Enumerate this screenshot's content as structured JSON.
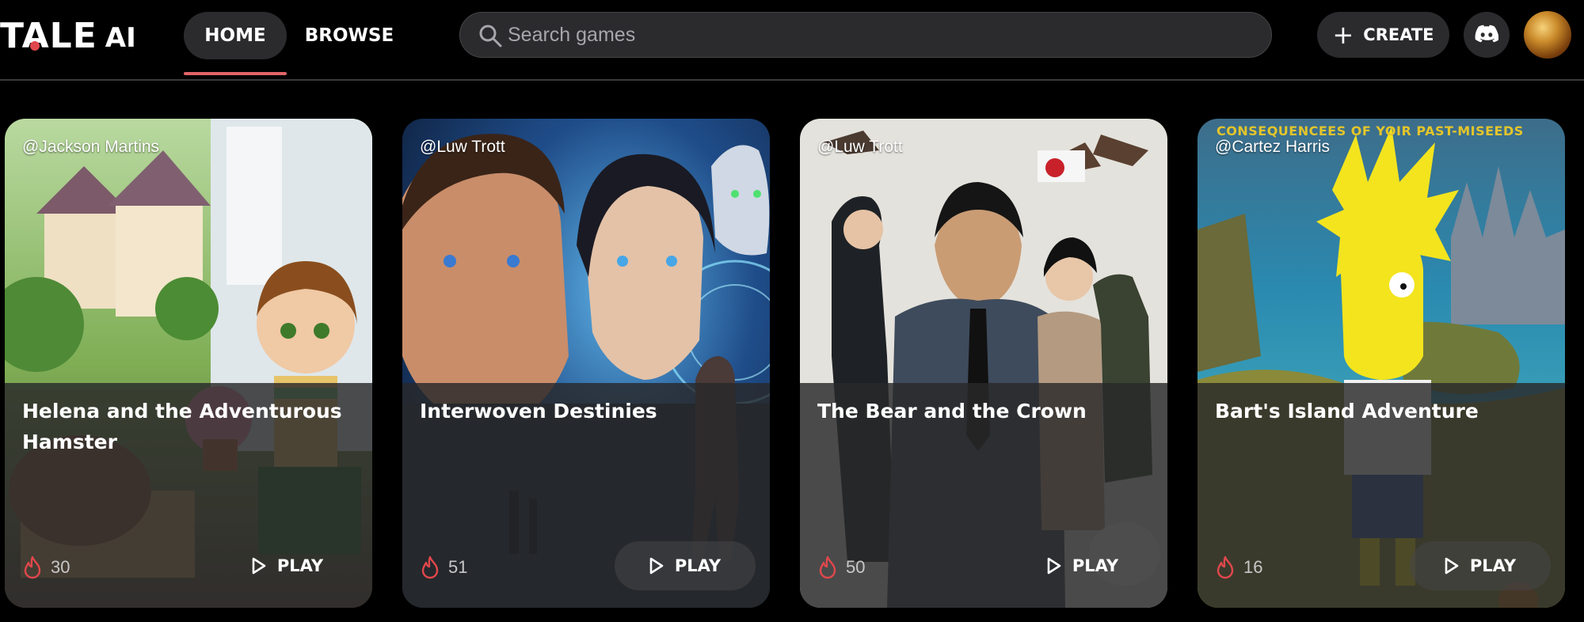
{
  "header": {
    "logo_tale": "TALE",
    "logo_ai": "AI",
    "nav": {
      "home": "HOME",
      "browse": "BROWSE"
    },
    "search": {
      "placeholder": "Search games"
    },
    "create_label": "CREATE",
    "icons": {
      "search": "search-icon",
      "create": "plus-icon",
      "discord": "discord-icon"
    }
  },
  "colors": {
    "accent": "#e0474c",
    "surface": "#2b2b2e",
    "background": "#000000"
  },
  "cards": [
    {
      "author": "@Jackson Martins",
      "title": "Helena and the Adventurous Hamster",
      "plays": "30",
      "play_label": "PLAY"
    },
    {
      "author": "@Luw Trott",
      "title": "Interwoven Destinies",
      "plays": "51",
      "play_label": "PLAY"
    },
    {
      "author": "@Luw Trott",
      "title": "The Bear and the Crown",
      "plays": "50",
      "play_label": "PLAY"
    },
    {
      "author": "@Cartez Harris",
      "title": "Bart's Island Adventure",
      "plays": "16",
      "play_label": "PLAY",
      "banner": "CONSEQUENCEES OF YOIR PAST-MISEEDS"
    }
  ]
}
